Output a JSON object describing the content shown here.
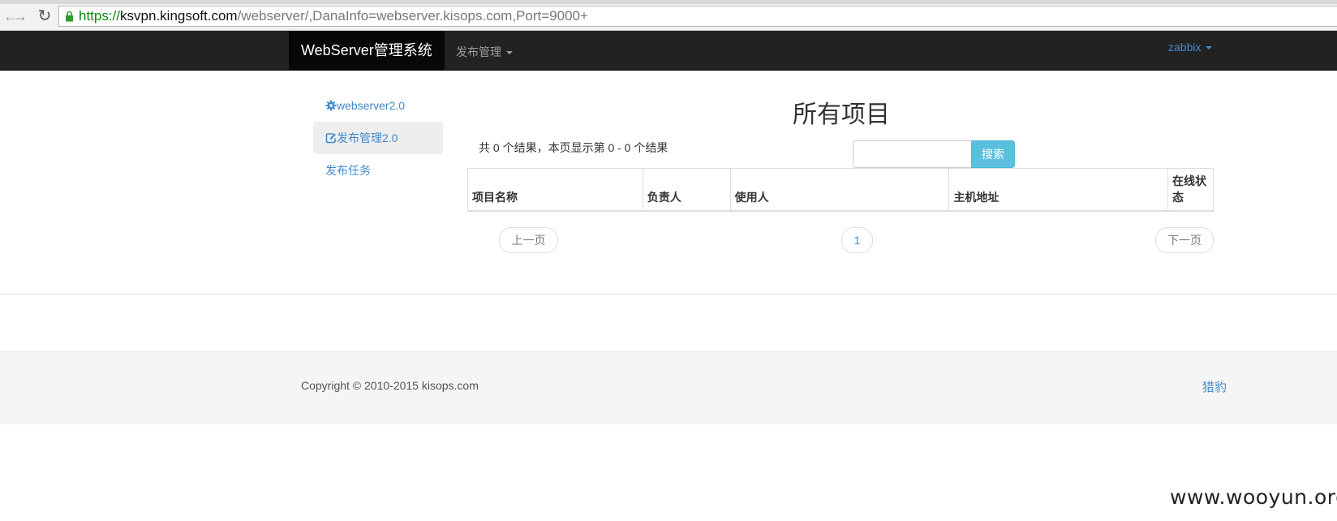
{
  "browser": {
    "url": {
      "scheme": "https://",
      "host": "ksvpn.kingsoft.com",
      "path": "/webserver/,DanaInfo=webserver.kisops.com,Port=9000+"
    }
  },
  "navbar": {
    "brand": "WebServer管理系统",
    "menu_label": "发布管理",
    "user_label": "zabbix"
  },
  "sidebar": {
    "items": [
      {
        "label": "webserver2.0",
        "icon": "gear-icon"
      },
      {
        "label": "发布管理2.0",
        "icon": "edit-icon"
      },
      {
        "label": "发布任务"
      }
    ]
  },
  "main": {
    "title": "所有项目",
    "summary": "共 0 个结果，本页显示第 0 - 0 个结果",
    "search_button": "搜索",
    "search_value": "",
    "table": {
      "columns": [
        "项目名称",
        "负责人",
        "使用人",
        "主机地址",
        "在线状态"
      ]
    },
    "pager": {
      "prev": "上一页",
      "current": "1",
      "next": "下一页"
    }
  },
  "footer": {
    "copyright": "Copyright © 2010-2015 kisops.com",
    "link": "猎豹"
  },
  "watermark": "www.wooyun.org",
  "colors": {
    "navbar_bg": "#222222",
    "brand_bg": "#080808",
    "link": "#428bca",
    "search_button": "#5bc0de"
  }
}
